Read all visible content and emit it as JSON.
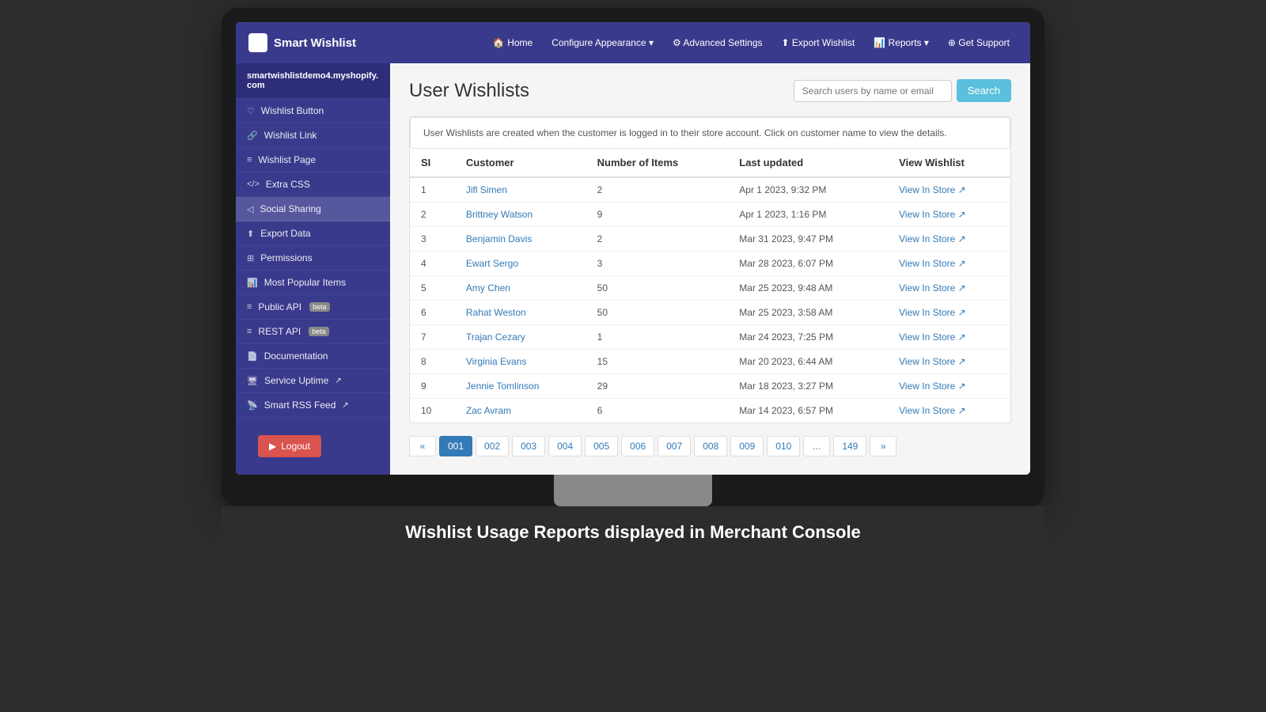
{
  "brand": {
    "icon": "🛍",
    "name": "Smart Wishlist"
  },
  "nav": {
    "links": [
      {
        "id": "home",
        "label": "🏠 Home",
        "icon": "home-icon"
      },
      {
        "id": "configure",
        "label": "Configure Appearance ▾",
        "icon": "configure-icon"
      },
      {
        "id": "advanced",
        "label": "⚙ Advanced Settings",
        "icon": "advanced-icon"
      },
      {
        "id": "export",
        "label": "⬆ Export Wishlist",
        "icon": "export-icon"
      },
      {
        "id": "reports",
        "label": "📊 Reports ▾",
        "icon": "reports-icon"
      },
      {
        "id": "support",
        "label": "⊕ Get Support",
        "icon": "support-icon"
      }
    ]
  },
  "sidebar": {
    "store": "smartwishlistdemo4.myshopify.\ncom",
    "items": [
      {
        "id": "wishlist-button",
        "icon": "♡",
        "label": "Wishlist Button"
      },
      {
        "id": "wishlist-link",
        "icon": "🔗",
        "label": "Wishlist Link"
      },
      {
        "id": "wishlist-page",
        "icon": "≡",
        "label": "Wishlist Page"
      },
      {
        "id": "extra-css",
        "icon": "</>",
        "label": "Extra CSS"
      },
      {
        "id": "social-sharing",
        "icon": "◁",
        "label": "Social Sharing"
      },
      {
        "id": "export-data",
        "icon": "⬆",
        "label": "Export Data"
      },
      {
        "id": "permissions",
        "icon": "⊞",
        "label": "Permissions"
      },
      {
        "id": "most-popular",
        "icon": "📊",
        "label": "Most Popular Items"
      },
      {
        "id": "public-api",
        "icon": "≡",
        "label": "Public API",
        "badge": "beta"
      },
      {
        "id": "rest-api",
        "icon": "≡",
        "label": "REST API",
        "badge": "beta"
      },
      {
        "id": "documentation",
        "icon": "📄",
        "label": "Documentation"
      },
      {
        "id": "service-uptime",
        "icon": "🖥",
        "label": "Service Uptime",
        "external": true
      },
      {
        "id": "smart-rss",
        "icon": "📡",
        "label": "Smart RSS Feed",
        "external": true
      }
    ],
    "logout_label": "Logout"
  },
  "content": {
    "page_title": "User Wishlists",
    "search_placeholder": "Search users by name or email",
    "search_button": "Search",
    "info_text": "User Wishlists are created when the customer is logged in to their store account. Click on customer name to view the details.",
    "table": {
      "headers": [
        "SI",
        "Customer",
        "Number of Items",
        "Last updated",
        "View Wishlist"
      ],
      "rows": [
        {
          "si": 1,
          "customer": "Jifl Simen",
          "items": 2,
          "last_updated": "Apr 1 2023, 9:32 PM",
          "view_link": "View In Store"
        },
        {
          "si": 2,
          "customer": "Brittney Watson",
          "items": 9,
          "last_updated": "Apr 1 2023, 1:16 PM",
          "view_link": "View In Store"
        },
        {
          "si": 3,
          "customer": "Benjamin Davis",
          "items": 2,
          "last_updated": "Mar 31 2023, 9:47 PM",
          "view_link": "View In Store"
        },
        {
          "si": 4,
          "customer": "Ewart Sergo",
          "items": 3,
          "last_updated": "Mar 28 2023, 6:07 PM",
          "view_link": "View In Store"
        },
        {
          "si": 5,
          "customer": "Amy Chen",
          "items": 50,
          "last_updated": "Mar 25 2023, 9:48 AM",
          "view_link": "View In Store"
        },
        {
          "si": 6,
          "customer": "Rahat Weston",
          "items": 50,
          "last_updated": "Mar 25 2023, 3:58 AM",
          "view_link": "View In Store"
        },
        {
          "si": 7,
          "customer": "Trajan Cezary",
          "items": 1,
          "last_updated": "Mar 24 2023, 7:25 PM",
          "view_link": "View In Store"
        },
        {
          "si": 8,
          "customer": "Virginia Evans",
          "items": 15,
          "last_updated": "Mar 20 2023, 6:44 AM",
          "view_link": "View In Store"
        },
        {
          "si": 9,
          "customer": "Jennie Tomlinson",
          "items": 29,
          "last_updated": "Mar 18 2023, 3:27 PM",
          "view_link": "View In Store"
        },
        {
          "si": 10,
          "customer": "Zac Avram",
          "items": 6,
          "last_updated": "Mar 14 2023, 6:57 PM",
          "view_link": "View In Store"
        }
      ]
    },
    "pagination": {
      "prev": "«",
      "next": "»",
      "ellipsis": "...",
      "pages": [
        "001",
        "002",
        "003",
        "004",
        "005",
        "006",
        "007",
        "008",
        "009",
        "010"
      ],
      "last_page": "149",
      "active_page": "001"
    }
  },
  "bottom_banner": "Wishlist Usage Reports displayed in Merchant Console"
}
